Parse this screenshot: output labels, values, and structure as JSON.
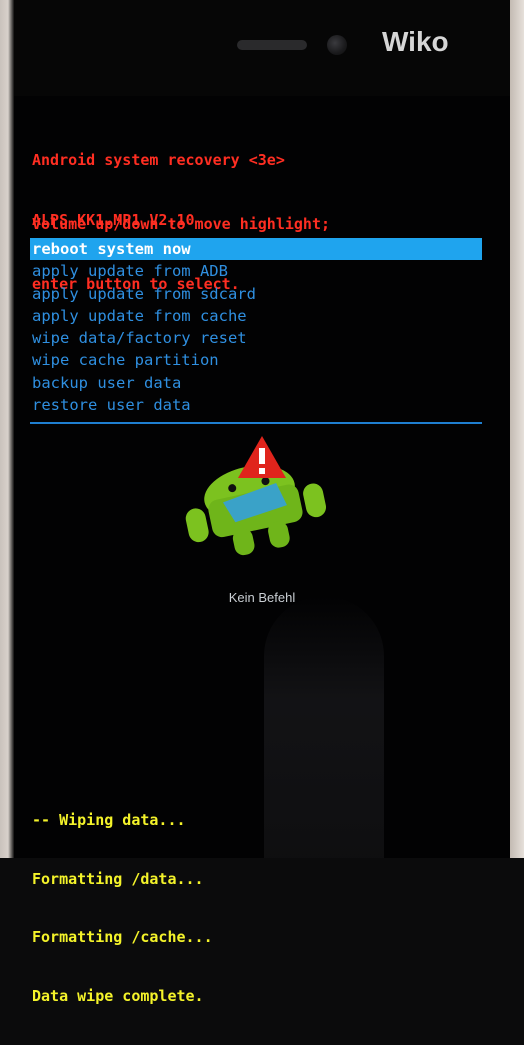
{
  "device": {
    "brand": "Wiko"
  },
  "recovery": {
    "header_lines": [
      "Android system recovery <3e>",
      "ALPS.KK1.MP1.V2.10"
    ],
    "instruction_lines": [
      "Volume up/down to move highlight;",
      "enter button to select."
    ],
    "menu": [
      {
        "label": "reboot system now",
        "selected": true
      },
      {
        "label": "apply update from ADB",
        "selected": false
      },
      {
        "label": "apply update from sdcard",
        "selected": false
      },
      {
        "label": "apply update from cache",
        "selected": false
      },
      {
        "label": "wipe data/factory reset",
        "selected": false
      },
      {
        "label": "wipe cache partition",
        "selected": false
      },
      {
        "label": "backup user data",
        "selected": false
      },
      {
        "label": "restore user data",
        "selected": false
      }
    ],
    "status_caption": "Kein Befehl",
    "log_lines": [
      "-- Wiping data...",
      "Formatting /data...",
      "Formatting /cache...",
      "Data wipe complete."
    ]
  },
  "colors": {
    "header_text": "#ff2e22",
    "menu_text": "#2f8fe0",
    "menu_highlight": "#1fa4ee",
    "log_text": "#f4f32a"
  },
  "icons": {
    "robot": "android-robot-warning-icon"
  }
}
